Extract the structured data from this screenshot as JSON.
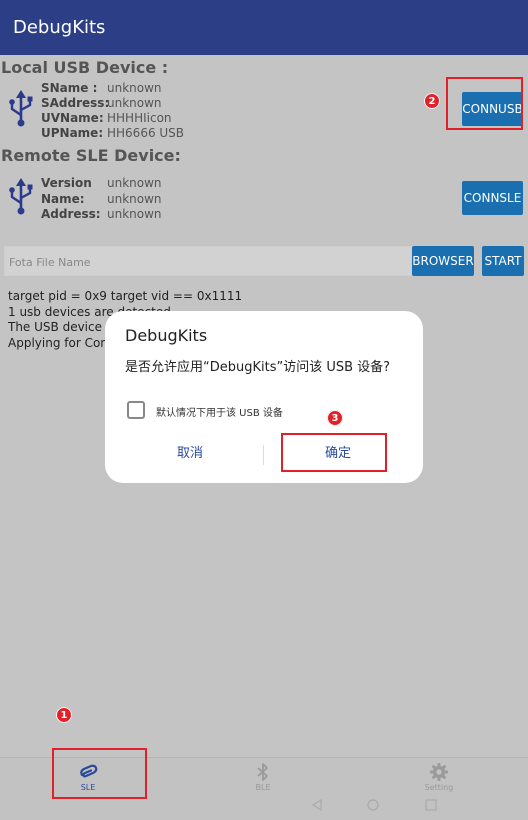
{
  "app": {
    "title": "DebugKits"
  },
  "local_usb": {
    "heading": "Local USB Device :",
    "fields": [
      {
        "key": "SName :",
        "value": "unknown"
      },
      {
        "key": "SAddress:",
        "value": "unknown"
      },
      {
        "key": "UVName:",
        "value": "HHHHIicon"
      },
      {
        "key": "UPName:",
        "value": "HH6666 USB"
      }
    ],
    "connect_label": "CONNUSB"
  },
  "remote_sle": {
    "heading": "Remote SLE Device:",
    "fields": [
      {
        "key": "Version",
        "value": "unknown"
      },
      {
        "key": "Name:",
        "value": "unknown"
      },
      {
        "key": "Address:",
        "value": "unknown"
      }
    ],
    "connect_label": "CONNSLE"
  },
  "fota": {
    "placeholder": "Fota File Name",
    "browse_label": "BROWSER",
    "start_label": "START"
  },
  "log": [
    "target pid  = 0x9 target vid == 0x1111",
    "1 usb devices are detected",
    "The USB device wi",
    "Applying for Conn"
  ],
  "dialog": {
    "title": "DebugKits",
    "message": "是否允许应用“DebugKits”访问该 USB 设备?",
    "checkbox_label": "默认情况下用于该 USB 设备",
    "checkbox_checked": false,
    "cancel_label": "取消",
    "ok_label": "确定"
  },
  "annotations": {
    "marker_1": "1",
    "marker_2": "2",
    "marker_3": "3"
  },
  "bottom_nav": {
    "items": [
      {
        "label": "SLE",
        "icon": "link-icon",
        "active": true
      },
      {
        "label": "BLE",
        "icon": "bluetooth-icon",
        "active": false
      },
      {
        "label": "Setting",
        "icon": "gear-icon",
        "active": false
      }
    ]
  },
  "colors": {
    "appbar": "#2c3e86",
    "button": "#1a6fb0",
    "highlight": "#e0212a",
    "dialog_accent": "#2c4a9c",
    "nav_active": "#2c4a9c",
    "nav_inactive": "#9a9a9a"
  }
}
